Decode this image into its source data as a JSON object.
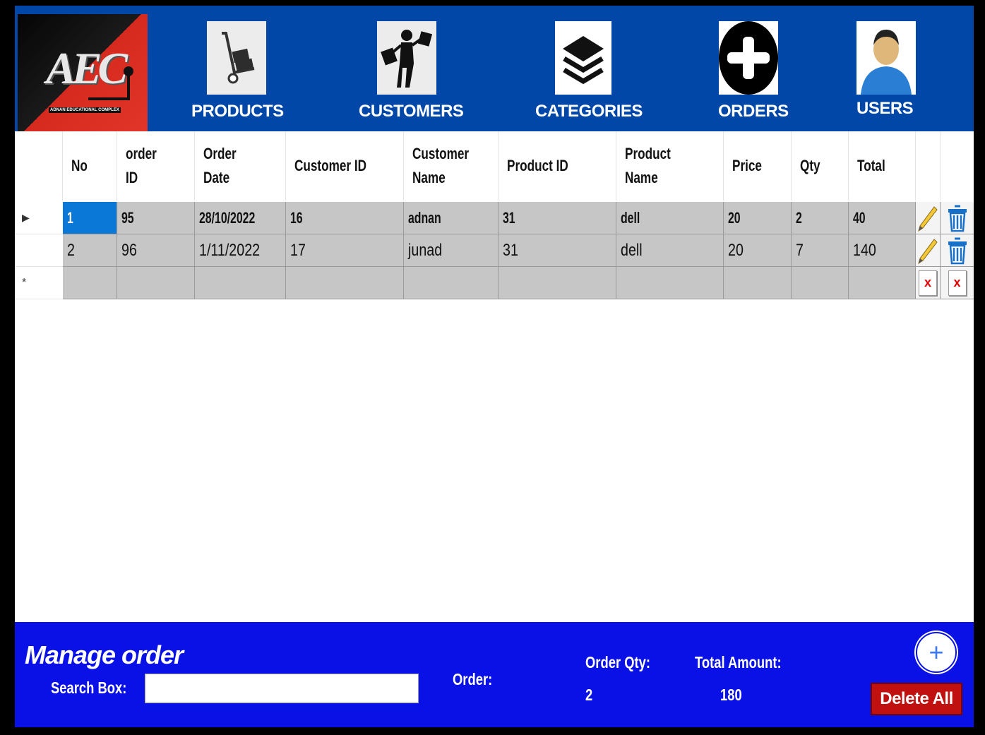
{
  "nav": [
    {
      "label": "PRODUCTS",
      "icon": "hand-truck-icon"
    },
    {
      "label": "CUSTOMERS",
      "icon": "shopper-icon"
    },
    {
      "label": "CATEGORIES",
      "icon": "layers-icon"
    },
    {
      "label": "ORDERS",
      "icon": "add-circle-icon"
    },
    {
      "label": "USERS",
      "icon": "user-icon"
    }
  ],
  "logo": {
    "text": "AEC",
    "subtitle": "ADNAN EDUCATIONAL COMPLEX"
  },
  "grid": {
    "columns": [
      "No",
      "order ID",
      "Order Date",
      "Customer ID",
      "Customer Name",
      "Product ID",
      "Product Name",
      "Price",
      "Qty",
      "Total"
    ],
    "rows": [
      [
        "1",
        "95",
        "28/10/2022",
        "16",
        "adnan",
        "31",
        "dell",
        "20",
        "2",
        "40"
      ],
      [
        "2",
        "96",
        "1/11/2022",
        "17",
        "junad",
        "31",
        "dell",
        "20",
        "7",
        "140"
      ]
    ],
    "new_row_marker": "*",
    "current_row_marker": "▶",
    "delete_placeholder": "x"
  },
  "footer": {
    "title": "Manage order",
    "search_label": "Search Box:",
    "search_value": "",
    "order_label": "Order:",
    "order_qty_label": "Order Qty:",
    "order_qty_value": "2",
    "total_amount_label": "Total Amount:",
    "total_amount_value": "180",
    "delete_all_label": "Delete All",
    "add_label": "+"
  },
  "colors": {
    "header_bg": "#0047a8",
    "footer_bg": "#0a11e6",
    "selection": "#0a78d7",
    "delete_btn": "#c01010"
  }
}
